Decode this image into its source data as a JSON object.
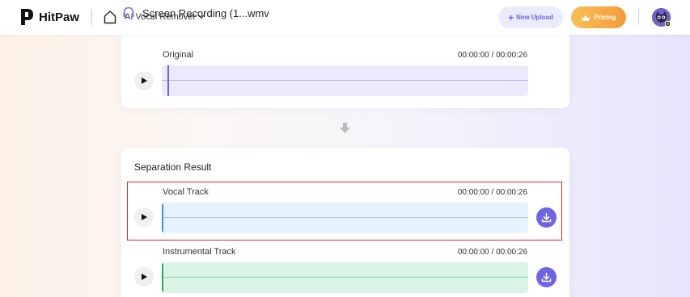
{
  "header": {
    "brand": "HitPaw",
    "breadcrumb": "AI Vocal Remover",
    "file_title": "Screen Recording (1...wmv",
    "new_upload_label": "New Upload",
    "pricing_label": "Pricing"
  },
  "original": {
    "label": "Original",
    "time": "00:00:00 / 00:00:26"
  },
  "result": {
    "title": "Separation Result",
    "tracks": [
      {
        "label": "Vocal Track",
        "time": "00:00:00 / 00:00:26"
      },
      {
        "label": "Instrumental Track",
        "time": "00:00:00 / 00:00:26"
      }
    ]
  },
  "colors": {
    "accent": "#6c63e6",
    "original_wave_bg": "#ece9fd",
    "vocal_wave_bg": "#e6f3fe",
    "instrumental_wave_bg": "#d9f4e5",
    "highlight": "#e0262b"
  },
  "icons": [
    "hitpaw-logo-icon",
    "home-icon",
    "headset-icon",
    "chevron-down-icon",
    "plus-icon",
    "crown-icon",
    "avatar",
    "play-icon",
    "arrow-down-icon",
    "download-icon"
  ]
}
